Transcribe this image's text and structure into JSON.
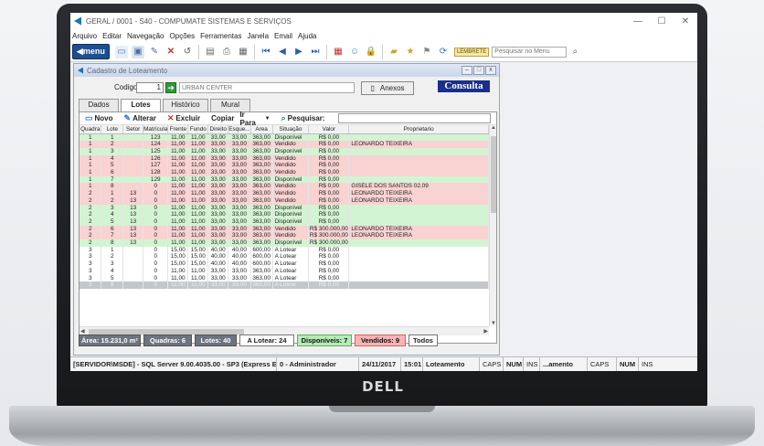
{
  "window": {
    "title": "GERAL / 0001 - S40 - COMPUMATE SISTEMAS E SERVIÇOS",
    "min": "—",
    "max": "☐",
    "close": "✕"
  },
  "menu": [
    "Arquivo",
    "Editar",
    "Navegação",
    "Opções",
    "Ferramentas",
    "Janela",
    "Email",
    "Ajuda"
  ],
  "toolbar": {
    "menu_label": "menu",
    "lembrete": "LEMBRETE",
    "search_placeholder": "Pesquisar no Menu"
  },
  "child": {
    "title": "Cadastro de Loteamento"
  },
  "form": {
    "codigo_label": "Codigo:",
    "codigo_value": "1",
    "name_value": "URBAN CENTER",
    "anexos_label": "Anexos",
    "consulta_label": "Consulta"
  },
  "tabs": [
    "Dados",
    "Lotes",
    "Histórico",
    "Mural"
  ],
  "grid_toolbar": {
    "novo": "Novo",
    "alterar": "Alterar",
    "excluir": "Excluir",
    "copiar": "Copiar",
    "ir_para": "Ir Para",
    "pesquisar": "Pesquisar:"
  },
  "columns": [
    "Quadra",
    "Lote",
    "Setor",
    "Matrícula",
    "Frente",
    "Fundo",
    "Direito",
    "Esque...",
    "Area",
    "Situação",
    "Valor",
    "Proprietario"
  ],
  "rows": [
    [
      "1",
      "1",
      "",
      "123",
      "11,00",
      "11,00",
      "33,00",
      "33,00",
      "363,00",
      "Disponível",
      "R$ 0,00",
      ""
    ],
    [
      "1",
      "2",
      "",
      "124",
      "11,00",
      "11,00",
      "33,00",
      "33,00",
      "363,00",
      "Vendido",
      "R$ 0,00",
      "LEONARDO TEIXEIRA"
    ],
    [
      "1",
      "3",
      "",
      "125",
      "11,00",
      "11,00",
      "33,00",
      "33,00",
      "363,00",
      "Disponível",
      "R$ 0,00",
      ""
    ],
    [
      "1",
      "4",
      "",
      "126",
      "11,00",
      "11,00",
      "33,00",
      "33,00",
      "363,00",
      "Vendido",
      "R$ 0,00",
      ""
    ],
    [
      "1",
      "5",
      "",
      "127",
      "11,00",
      "11,00",
      "33,00",
      "33,00",
      "363,00",
      "Vendido",
      "R$ 0,00",
      ""
    ],
    [
      "1",
      "6",
      "",
      "128",
      "11,00",
      "11,00",
      "33,00",
      "33,00",
      "363,00",
      "Vendido",
      "R$ 0,00",
      ""
    ],
    [
      "1",
      "7",
      "",
      "129",
      "11,00",
      "11,00",
      "33,00",
      "33,00",
      "363,00",
      "Disponível",
      "R$ 0,00",
      ""
    ],
    [
      "1",
      "8",
      "",
      "0",
      "11,00",
      "11,00",
      "33,00",
      "33,00",
      "363,00",
      "Vendido",
      "R$ 0,00",
      "GISELE DOS SANTOS 02.09"
    ],
    [
      "2",
      "1",
      "13",
      "0",
      "11,00",
      "11,00",
      "33,00",
      "33,00",
      "363,00",
      "Vendido",
      "R$ 0,00",
      "LEONARDO TEIXEIRA"
    ],
    [
      "2",
      "2",
      "13",
      "0",
      "11,00",
      "11,00",
      "33,00",
      "33,00",
      "363,00",
      "Vendido",
      "R$ 0,00",
      "LEONARDO TEIXEIRA"
    ],
    [
      "2",
      "3",
      "13",
      "0",
      "11,00",
      "11,00",
      "33,00",
      "33,00",
      "363,00",
      "Disponível",
      "R$ 0,00",
      ""
    ],
    [
      "2",
      "4",
      "13",
      "0",
      "11,00",
      "11,00",
      "33,00",
      "33,00",
      "363,00",
      "Disponível",
      "R$ 0,00",
      ""
    ],
    [
      "2",
      "5",
      "13",
      "0",
      "11,00",
      "11,00",
      "33,00",
      "33,00",
      "363,00",
      "Disponível",
      "R$ 0,00",
      ""
    ],
    [
      "2",
      "6",
      "13",
      "0",
      "11,00",
      "11,00",
      "33,00",
      "33,00",
      "363,00",
      "Vendido",
      "R$ 300.000,00",
      "LEONARDO TEIXEIRA"
    ],
    [
      "2",
      "7",
      "13",
      "0",
      "11,00",
      "11,00",
      "33,00",
      "33,00",
      "363,00",
      "Vendido",
      "R$ 300.000,00",
      "LEONARDO TEIXEIRA"
    ],
    [
      "2",
      "8",
      "13",
      "0",
      "11,00",
      "11,00",
      "33,00",
      "33,00",
      "363,00",
      "Disponível",
      "R$ 300.000,00",
      ""
    ],
    [
      "3",
      "1",
      "",
      "0",
      "15,00",
      "15,00",
      "40,00",
      "40,00",
      "600,00",
      "A Lotear",
      "R$ 0,00",
      ""
    ],
    [
      "3",
      "2",
      "",
      "0",
      "15,00",
      "15,00",
      "40,00",
      "40,00",
      "600,00",
      "A Lotear",
      "R$ 0,00",
      ""
    ],
    [
      "3",
      "3",
      "",
      "0",
      "15,00",
      "15,00",
      "40,00",
      "40,00",
      "600,00",
      "A Lotear",
      "R$ 0,00",
      ""
    ],
    [
      "3",
      "4",
      "",
      "0",
      "11,00",
      "11,00",
      "33,00",
      "33,00",
      "363,00",
      "A Lotear",
      "R$ 0,00",
      ""
    ],
    [
      "3",
      "5",
      "",
      "0",
      "11,00",
      "11,00",
      "33,00",
      "33,00",
      "363,00",
      "A Lotear",
      "R$ 0,00",
      ""
    ],
    [
      "3",
      "6",
      "",
      "0",
      "11,00",
      "11,00",
      "33,00",
      "33,00",
      "363,00",
      "A Lotear",
      "R$ 0,00",
      ""
    ]
  ],
  "summary": {
    "area": "Área: 15.231,0 m²",
    "quadras": "Quadras: 6",
    "lotes": "Lotes: 40",
    "lotear": "A Lotear: 24",
    "disponiveis": "Disponíveis: 7",
    "vendidos": "Vendidos: 9",
    "todos": "Todos"
  },
  "statusbar": {
    "server": "[SERVIDOR\\MSDE] - SQL Server 9.00.4035.00 - SP3 (Express Edition)",
    "user": "0 - Administrador",
    "date": "24/11/2017",
    "time": "15:01",
    "module": "Loteamento",
    "caps": "CAPS",
    "num": "NUM",
    "ins": "INS",
    "extra": "...amento",
    "caps2": "CAPS",
    "num2": "NUM",
    "ins2": "INS"
  },
  "brand": "DELL"
}
